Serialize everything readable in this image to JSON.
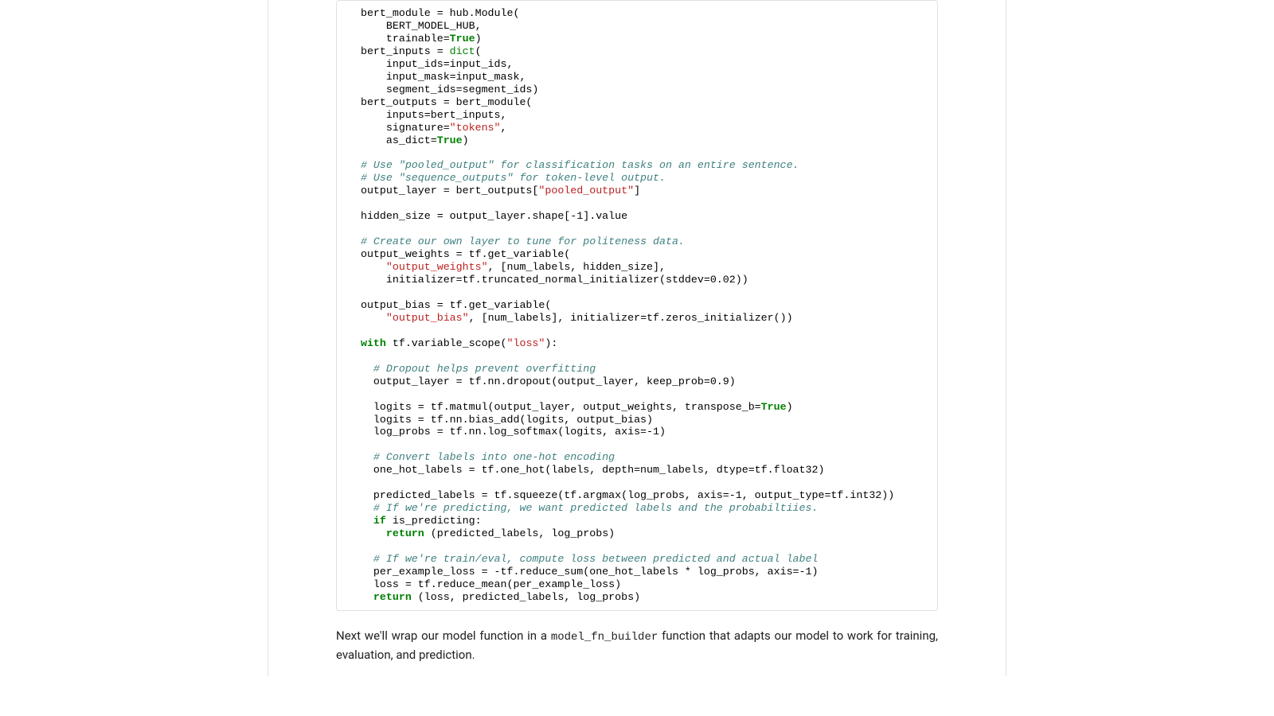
{
  "code": {
    "l01": "  bert_module = hub.Module(",
    "l02": "      BERT_MODEL_HUB,",
    "l03a": "      trainable=",
    "l03b": "True",
    "l03c": ")",
    "l04a": "  bert_inputs = ",
    "l04b": "dict",
    "l04c": "(",
    "l05": "      input_ids=input_ids,",
    "l06": "      input_mask=input_mask,",
    "l07": "      segment_ids=segment_ids)",
    "l08": "  bert_outputs = bert_module(",
    "l09": "      inputs=bert_inputs,",
    "l10a": "      signature=",
    "l10b": "\"tokens\"",
    "l10c": ",",
    "l11a": "      as_dict=",
    "l11b": "True",
    "l11c": ")",
    "l12": "",
    "l13": "  # Use \"pooled_output\" for classification tasks on an entire sentence.",
    "l14": "  # Use \"sequence_outputs\" for token-level output.",
    "l15a": "  output_layer = bert_outputs[",
    "l15b": "\"pooled_output\"",
    "l15c": "]",
    "l16": "",
    "l17": "  hidden_size = output_layer.shape[-1].value",
    "l18": "",
    "l19": "  # Create our own layer to tune for politeness data.",
    "l20": "  output_weights = tf.get_variable(",
    "l21a": "      ",
    "l21b": "\"output_weights\"",
    "l21c": ", [num_labels, hidden_size],",
    "l22": "      initializer=tf.truncated_normal_initializer(stddev=0.02))",
    "l23": "",
    "l24": "  output_bias = tf.get_variable(",
    "l25a": "      ",
    "l25b": "\"output_bias\"",
    "l25c": ", [num_labels], initializer=tf.zeros_initializer())",
    "l26": "",
    "l27a": "  ",
    "l27b": "with",
    "l27c": " tf.variable_scope(",
    "l27d": "\"loss\"",
    "l27e": "):",
    "l28": "",
    "l29": "    # Dropout helps prevent overfitting",
    "l30": "    output_layer = tf.nn.dropout(output_layer, keep_prob=0.9)",
    "l31": "",
    "l32a": "    logits = tf.matmul(output_layer, output_weights, transpose_b=",
    "l32b": "True",
    "l32c": ")",
    "l33": "    logits = tf.nn.bias_add(logits, output_bias)",
    "l34": "    log_probs = tf.nn.log_softmax(logits, axis=-1)",
    "l35": "",
    "l36": "    # Convert labels into one-hot encoding",
    "l37": "    one_hot_labels = tf.one_hot(labels, depth=num_labels, dtype=tf.float32)",
    "l38": "",
    "l39": "    predicted_labels = tf.squeeze(tf.argmax(log_probs, axis=-1, output_type=tf.int32))",
    "l40": "    # If we're predicting, we want predicted labels and the probabiltiies.",
    "l41a": "    ",
    "l41b": "if",
    "l41c": " is_predicting:",
    "l42a": "      ",
    "l42b": "return",
    "l42c": " (predicted_labels, log_probs)",
    "l43": "",
    "l44": "    # If we're train/eval, compute loss between predicted and actual label",
    "l45": "    per_example_loss = -tf.reduce_sum(one_hot_labels * log_probs, axis=-1)",
    "l46": "    loss = tf.reduce_mean(per_example_loss)",
    "l47a": "    ",
    "l47b": "return",
    "l47c": " (loss, predicted_labels, log_probs)"
  },
  "prose": {
    "p1a": "Next we'll wrap our model function in a ",
    "p1b": "model_fn_builder",
    "p1c": " function that adapts our model to work for training, evaluation, and prediction."
  }
}
